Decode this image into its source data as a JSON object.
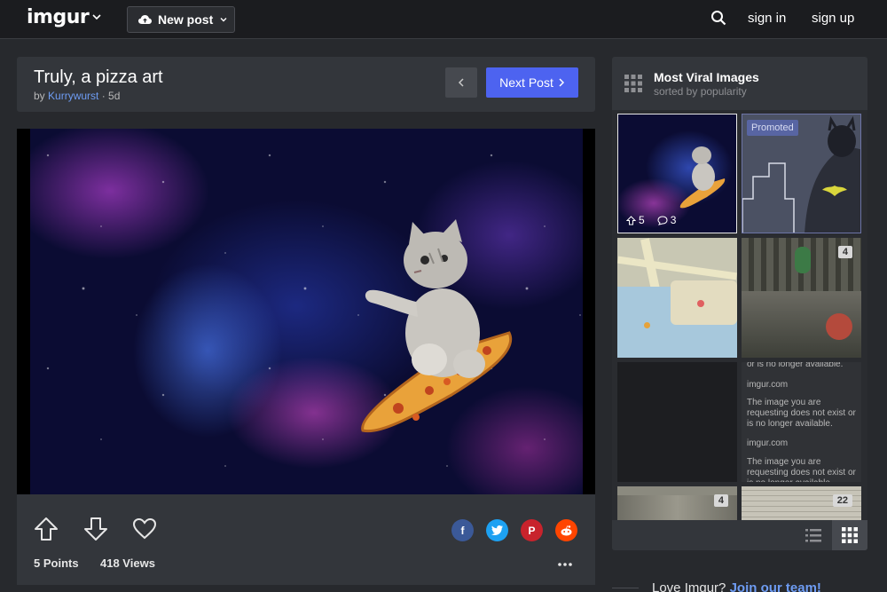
{
  "topbar": {
    "logo": "imgur",
    "new_post": "New post",
    "sign_in": "sign in",
    "sign_up": "sign up"
  },
  "post": {
    "title": "Truly, a pizza art",
    "by": "by",
    "author": "Kurrywurst",
    "age": "· 5d",
    "next_label": "Next Post",
    "points": "5 Points",
    "views": "418 Views"
  },
  "sidebar": {
    "title": "Most Viral Images",
    "subtitle": "sorted by popularity",
    "thumbs": [
      {
        "upvotes": "5",
        "comments": "3"
      },
      {
        "badge": "Promoted"
      },
      {},
      {
        "count": "4"
      },
      {},
      {
        "lines": [
          "or is no longer available.",
          "imgur.com",
          "The image you are requesting does not exist or is no longer available.",
          "imgur.com",
          "The image you are requesting does not exist or is no longer available."
        ]
      },
      {
        "count": "4"
      },
      {
        "count": "22"
      }
    ]
  },
  "footer_banner": {
    "text": "Love Imgur?",
    "link": "Join our team!"
  },
  "colors": {
    "accent": "#4d63f0",
    "link": "#6e9cf3",
    "background": "#27292d",
    "panel": "#33363b",
    "facebook": "#3b5998",
    "twitter": "#1da1f2",
    "pinterest": "#c8232c",
    "reddit": "#ff4500"
  }
}
